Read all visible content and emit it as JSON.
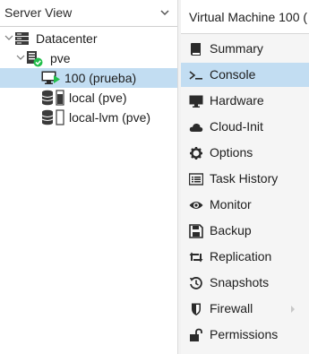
{
  "view_selector": {
    "label": "Server View"
  },
  "tree": {
    "datacenter": "Datacenter",
    "node": "pve",
    "vm": "100 (prueba)",
    "storage_local": "local (pve)",
    "storage_lvm": "local-lvm (pve)"
  },
  "vm_panel": {
    "title": "Virtual Machine 100 (",
    "menu": [
      {
        "label": "Summary",
        "icon": "book-icon"
      },
      {
        "label": "Console",
        "icon": "terminal-icon"
      },
      {
        "label": "Hardware",
        "icon": "desktop-icon"
      },
      {
        "label": "Cloud-Init",
        "icon": "cloud-icon"
      },
      {
        "label": "Options",
        "icon": "gear-icon"
      },
      {
        "label": "Task History",
        "icon": "list-icon"
      },
      {
        "label": "Monitor",
        "icon": "eye-icon"
      },
      {
        "label": "Backup",
        "icon": "floppy-icon"
      },
      {
        "label": "Replication",
        "icon": "retweet-icon"
      },
      {
        "label": "Snapshots",
        "icon": "history-icon"
      },
      {
        "label": "Firewall",
        "icon": "shield-icon"
      },
      {
        "label": "Permissions",
        "icon": "unlock-icon"
      }
    ],
    "active": "Console"
  },
  "colors": {
    "selection": "#c2ddf2",
    "running_green": "#21bf4b",
    "icon_dark": "#2b2b2b"
  }
}
